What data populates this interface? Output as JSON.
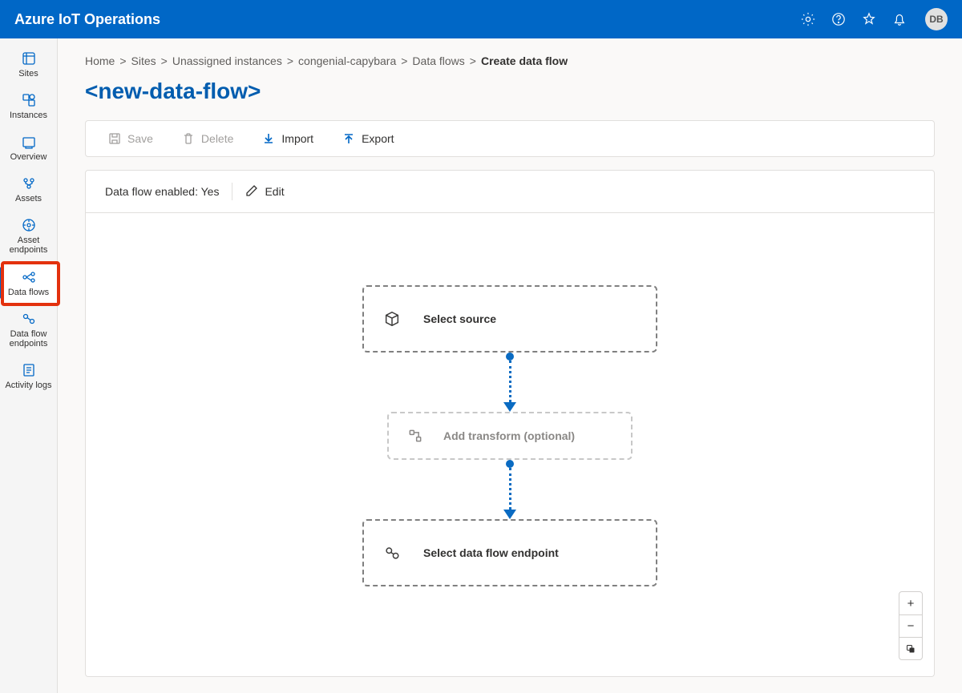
{
  "header": {
    "title": "Azure IoT Operations",
    "avatar": "DB"
  },
  "sidebar": {
    "items": [
      {
        "label": "Sites"
      },
      {
        "label": "Instances"
      },
      {
        "label": "Overview"
      },
      {
        "label": "Assets"
      },
      {
        "label": "Asset endpoints"
      },
      {
        "label": "Data flows"
      },
      {
        "label": "Data flow endpoints"
      },
      {
        "label": "Activity logs"
      }
    ]
  },
  "breadcrumb": {
    "items": [
      "Home",
      "Sites",
      "Unassigned instances",
      "congenial-capybara",
      "Data flows"
    ],
    "current": "Create data flow"
  },
  "page": {
    "title": "<new-data-flow>"
  },
  "toolbar": {
    "save": "Save",
    "delete": "Delete",
    "import": "Import",
    "export": "Export"
  },
  "status": {
    "enabled_label": "Data flow enabled: Yes",
    "edit": "Edit"
  },
  "flow": {
    "source": "Select source",
    "transform": "Add transform (optional)",
    "endpoint": "Select data flow endpoint"
  },
  "zoom": {
    "in": "+",
    "out": "−",
    "fit": "⛶"
  }
}
